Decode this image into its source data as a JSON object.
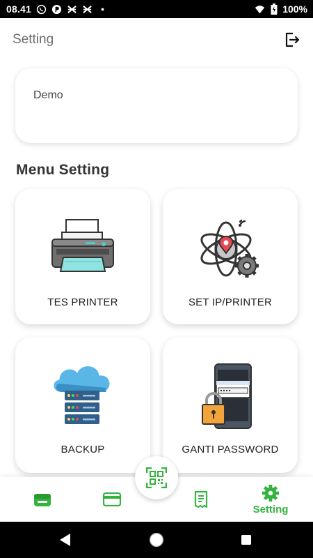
{
  "status_bar": {
    "time": "08.41",
    "battery": "100%",
    "icons": [
      "whatsapp-icon",
      "data-saver-icon",
      "xl-icon",
      "xl-icon",
      "dot-icon",
      "wifi-icon",
      "battery-icon"
    ]
  },
  "app_bar": {
    "title": "Setting",
    "logout_icon": "logout-icon"
  },
  "company": {
    "name": "Demo"
  },
  "menu": {
    "title": "Menu Setting",
    "items": [
      {
        "label": "TES PRINTER",
        "icon": "printer-illustration"
      },
      {
        "label": "SET IP/PRINTER",
        "icon": "network-gear-illustration"
      },
      {
        "label": "BACKUP",
        "icon": "cloud-server-illustration"
      },
      {
        "label": "GANTI PASSWORD",
        "icon": "phone-lock-illustration"
      }
    ]
  },
  "bottom_nav": {
    "items": [
      {
        "label": "",
        "icon": "wallet-icon"
      },
      {
        "label": "",
        "icon": "credit-card-icon"
      },
      {
        "label": "",
        "icon": "receipt-icon"
      },
      {
        "label": "Setting",
        "icon": "gear-icon",
        "active": true
      }
    ],
    "fab_icon": "qr-scan-icon"
  },
  "colors": {
    "accent": "#34b33e",
    "status_bar": "#000000",
    "background": "#ffffff"
  }
}
